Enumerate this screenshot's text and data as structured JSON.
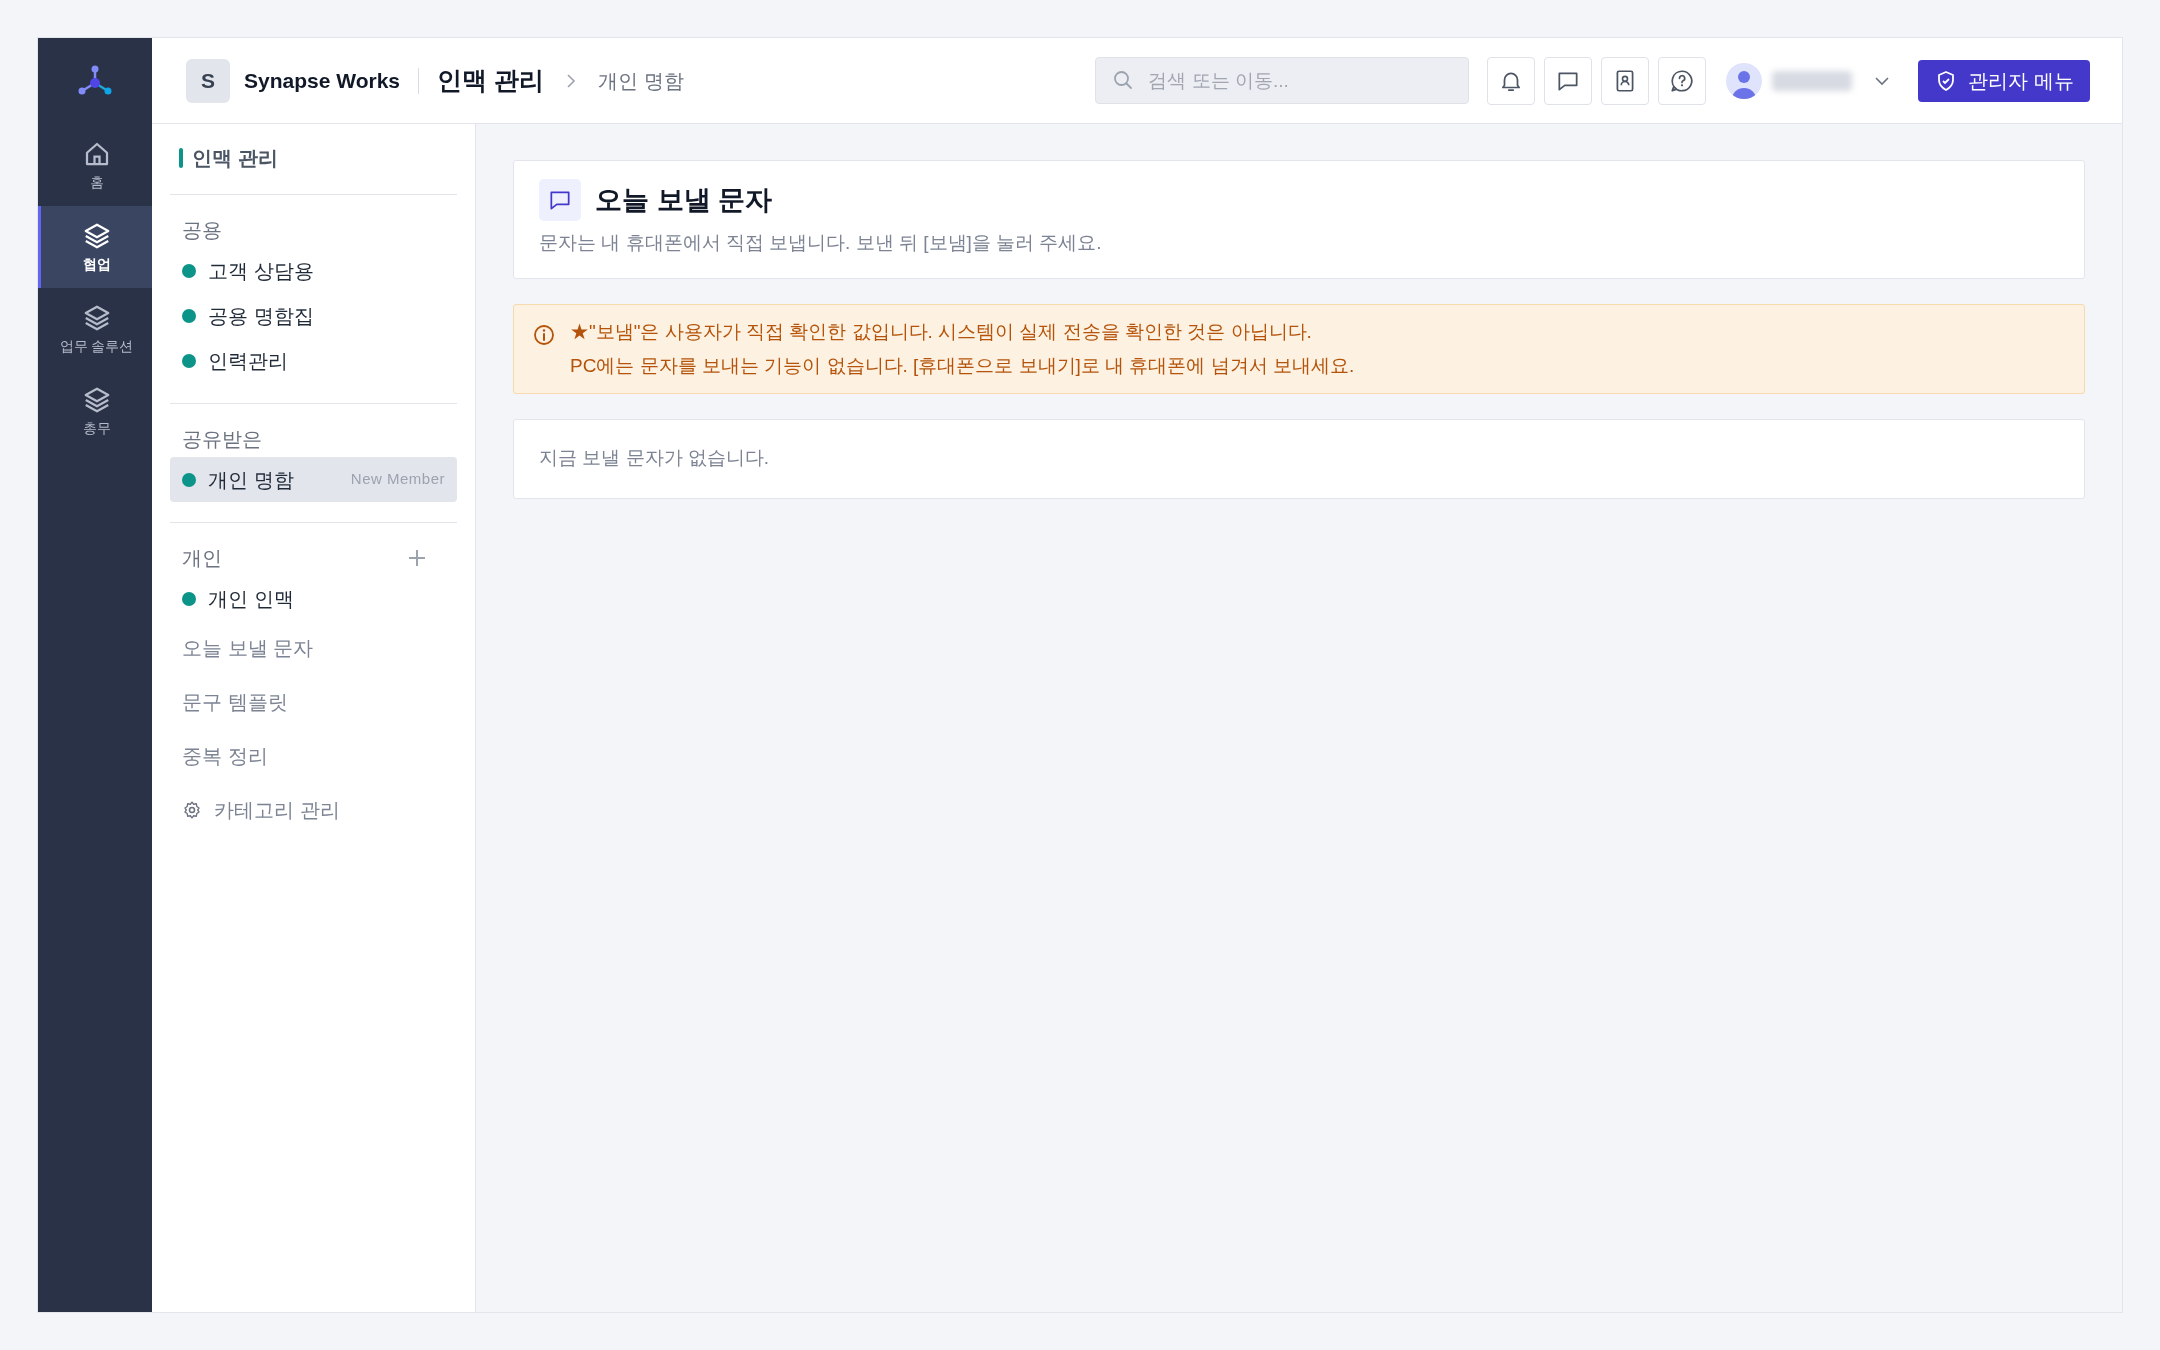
{
  "rail": [
    {
      "label": "홈",
      "selected": false
    },
    {
      "label": "협업",
      "selected": true
    },
    {
      "label": "업무 솔루션",
      "selected": false
    },
    {
      "label": "총무",
      "selected": false
    }
  ],
  "header": {
    "workspace_initial": "S",
    "workspace": "Synapse Works",
    "title": "인맥 관리",
    "breadcrumb": "개인 명함",
    "search": {
      "placeholder": "검색 또는 이동..."
    },
    "admin_button": "관리자 메뉴"
  },
  "sidebar": {
    "title": "인맥 관리",
    "sections": [
      {
        "label": "공용",
        "items": [
          {
            "kind": "dot",
            "label": "고객 상담용",
            "selected": false
          },
          {
            "kind": "dot",
            "label": "공용 명함집",
            "selected": false
          },
          {
            "kind": "dot",
            "label": "인력관리",
            "selected": false
          }
        ]
      },
      {
        "label": "공유받은",
        "items": [
          {
            "kind": "dot",
            "label": "개인 명함",
            "badge": "New Member",
            "selected": true
          }
        ]
      },
      {
        "label": "개인",
        "add": true,
        "items": [
          {
            "kind": "dot",
            "label": "개인 인맥",
            "selected": false
          },
          {
            "kind": "link",
            "label": "오늘 보낼 문자",
            "selected": false
          },
          {
            "kind": "link",
            "label": "문구 템플릿",
            "selected": false
          },
          {
            "kind": "link",
            "label": "중복 정리",
            "selected": false
          },
          {
            "kind": "settings",
            "label": "카테고리 관리",
            "selected": false
          }
        ]
      }
    ]
  },
  "page": {
    "title": "오늘 보낼 문자",
    "subtitle": "문자는 내 휴대폰에서 직접 보냅니다. 보낸 뒤 [보냄]을 눌러 주세요.",
    "notice": [
      "★\"보냄\"은 사용자가 직접 확인한 값입니다. 시스템이 실제 전송을 확인한 것은 아닙니다.",
      "PC에는 문자를 보내는 기능이 없습니다. [휴대폰으로 보내기]로 내 휴대폰에 넘겨서 보내세요."
    ],
    "empty": "지금 보낼 문자가 없습니다."
  }
}
